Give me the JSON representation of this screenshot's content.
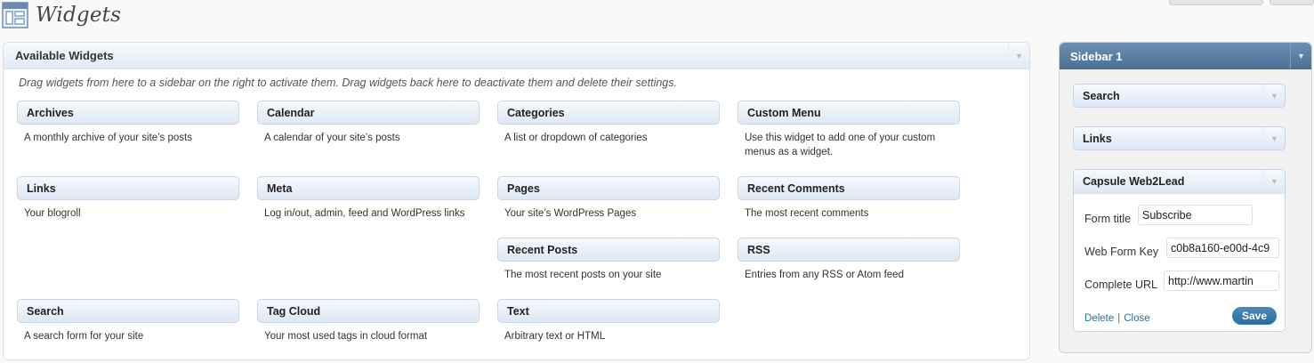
{
  "page": {
    "title": "Widgets"
  },
  "available": {
    "title": "Available Widgets",
    "description": "Drag widgets from here to a sidebar on the right to activate them. Drag widgets back here to deactivate them and delete their settings.",
    "widgets": [
      {
        "title": "Archives",
        "desc": "A monthly archive of your site’s posts"
      },
      {
        "title": "Calendar",
        "desc": "A calendar of your site’s posts"
      },
      {
        "title": "Categories",
        "desc": "A list or dropdown of categories"
      },
      {
        "title": "Custom Menu",
        "desc": "Use this widget to add one of your custom menus as a widget."
      },
      {
        "title": "Links",
        "desc": "Your blogroll"
      },
      {
        "title": "Meta",
        "desc": "Log in/out, admin, feed and WordPress links"
      },
      {
        "title": "Pages",
        "desc": "Your site’s WordPress Pages"
      },
      {
        "title": "Recent Comments",
        "desc": "The most recent comments"
      },
      {
        "title": "Recent Posts",
        "desc": "The most recent posts on your site"
      },
      {
        "title": "RSS",
        "desc": "Entries from any RSS or Atom feed"
      },
      {
        "title": "Search",
        "desc": "A search form for your site"
      },
      {
        "title": "Tag Cloud",
        "desc": "Your most used tags in cloud format"
      },
      {
        "title": "Text",
        "desc": "Arbitrary text or HTML"
      }
    ]
  },
  "sidebar": {
    "title": "Sidebar 1",
    "widgets": [
      {
        "title": "Search"
      },
      {
        "title": "Links"
      }
    ],
    "open_widget": {
      "title": "Capsule Web2Lead",
      "fields": [
        {
          "label": "Form title",
          "value": "Subscribe"
        },
        {
          "label": "Web Form Key",
          "value": "c0b8a160-e00d-4c9"
        },
        {
          "label": "Complete URL",
          "value": "http://www.martin"
        }
      ],
      "delete_label": "Delete",
      "separator": "|",
      "close_label": "Close",
      "save_label": "Save"
    }
  },
  "colors": {
    "sidebar_header": "#4b6f96",
    "link": "#21759b",
    "save_button": "#2e6a9b"
  }
}
